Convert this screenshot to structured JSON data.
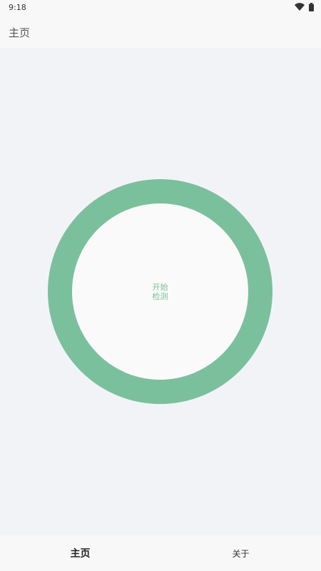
{
  "status_bar": {
    "time": "9:18",
    "icons": [
      "wifi-icon",
      "battery-icon"
    ]
  },
  "app_bar": {
    "title": "主页"
  },
  "main": {
    "start_button": {
      "line1": "开始",
      "line2": "检测",
      "accent_color": "#7bc09c"
    }
  },
  "bottom_nav": {
    "items": [
      {
        "label": "主页",
        "active": true
      },
      {
        "label": "关于",
        "active": false
      }
    ]
  },
  "colors": {
    "background": "#f2f3f7",
    "bar_background": "#f8f8f8",
    "accent": "#7bc09c"
  }
}
